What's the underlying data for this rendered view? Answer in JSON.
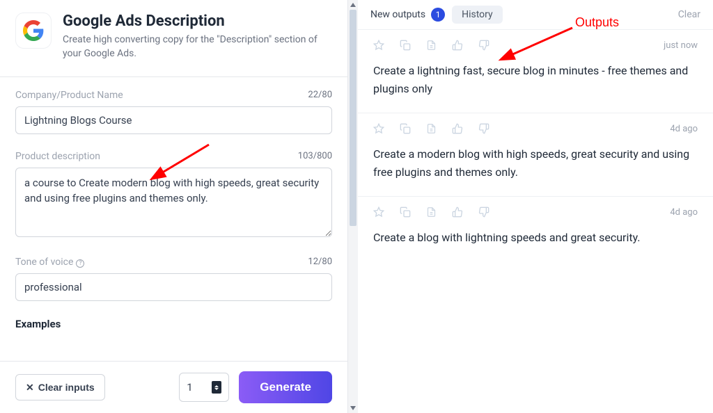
{
  "header": {
    "title": "Google Ads Description",
    "subtitle": "Create high converting copy for the \"Description\" section of your Google Ads."
  },
  "fields": {
    "company": {
      "label": "Company/Product Name",
      "value": "Lightning Blogs Course",
      "counter": "22/80"
    },
    "description": {
      "label": "Product description",
      "value": "a course to Create modern blog with high speeds, great security and using free plugins and themes only.",
      "counter": "103/800"
    },
    "tone": {
      "label": "Tone of voice",
      "value": "professional",
      "counter": "12/80"
    },
    "examples_heading": "Examples"
  },
  "bottom": {
    "clear_label": "Clear inputs",
    "count_value": "1",
    "generate_label": "Generate"
  },
  "tabs": {
    "new_label": "New outputs",
    "new_badge": "1",
    "history_label": "History",
    "clear_label": "Clear"
  },
  "outputs": [
    {
      "time": "just now",
      "text": "Create a lightning fast, secure blog in minutes - free themes and plugins only"
    },
    {
      "time": "4d ago",
      "text": "Create a modern blog with high speeds, great security and using free plugins and themes only."
    },
    {
      "time": "4d ago",
      "text": "Create a blog with lightning speeds and great security."
    }
  ],
  "annotation": {
    "outputs_label": "Outputs"
  }
}
